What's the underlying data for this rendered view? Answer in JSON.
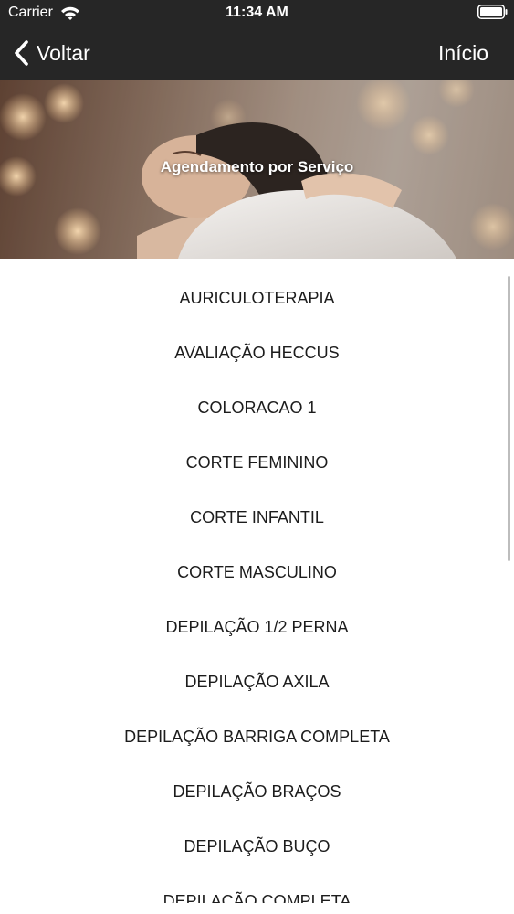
{
  "status_bar": {
    "carrier": "Carrier",
    "time": "11:34 AM",
    "wifi_icon": "wifi-icon",
    "battery_icon": "battery-icon"
  },
  "nav": {
    "back_label": "Voltar",
    "back_icon": "chevron-left-icon",
    "home_label": "Início"
  },
  "hero": {
    "title": "Agendamento por Serviço"
  },
  "services": [
    {
      "label": "AURICULOTERAPIA"
    },
    {
      "label": "AVALIAÇÃO HECCUS"
    },
    {
      "label": "COLORACAO 1"
    },
    {
      "label": "CORTE FEMININO"
    },
    {
      "label": "CORTE INFANTIL"
    },
    {
      "label": "CORTE MASCULINO"
    },
    {
      "label": "DEPILAÇÃO 1/2 PERNA"
    },
    {
      "label": "DEPILAÇÃO AXILA"
    },
    {
      "label": "DEPILAÇÃO BARRIGA COMPLETA"
    },
    {
      "label": "DEPILAÇÃO BRAÇOS"
    },
    {
      "label": "DEPILAÇÃO BUÇO"
    },
    {
      "label": "DEPILAÇÃO COMPLETA"
    }
  ],
  "colors": {
    "top_bar": "#262626",
    "text_primary": "#1c1c1c",
    "background": "#ffffff"
  }
}
